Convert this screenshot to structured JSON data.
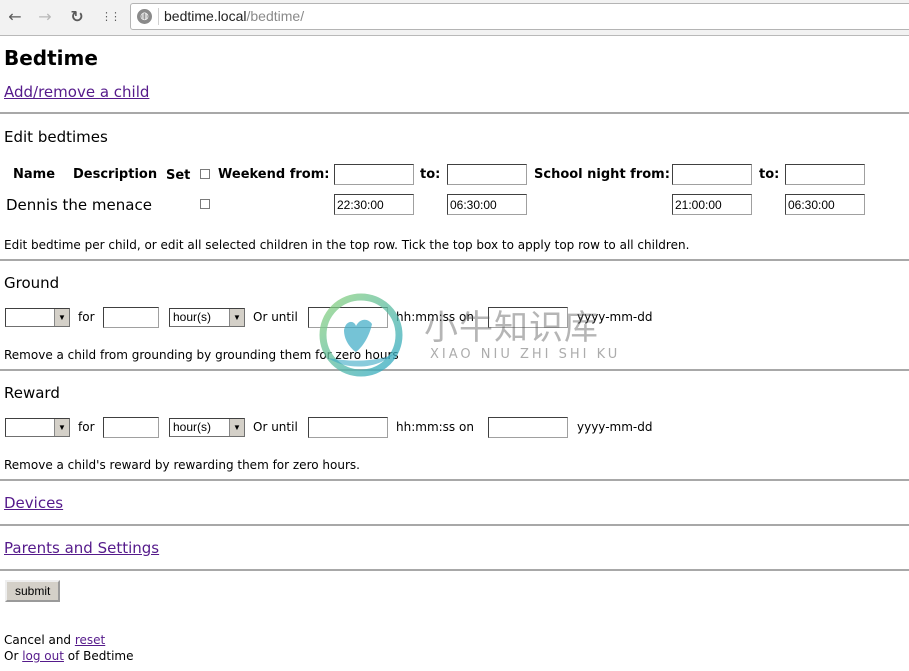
{
  "browser": {
    "url_host": "bedtime.local",
    "url_path": "/bedtime/",
    "back_icon": "←",
    "forward_icon": "→",
    "reload_icon": "↻",
    "apps_icon": "⋮⋮",
    "site_icon": "◍"
  },
  "page": {
    "title": "Bedtime",
    "add_remove_link": "Add/remove a child"
  },
  "edit_bedtimes": {
    "heading": "Edit bedtimes",
    "columns": {
      "name": "Name",
      "description": "Description",
      "set": "Set",
      "weekend_from": "Weekend from:",
      "to1": "to:",
      "school_night_from": "School night from:",
      "to2": "to:"
    },
    "top_row": {
      "set_checked": false,
      "weekend_from": "",
      "weekend_to": "",
      "school_from": "",
      "school_to": ""
    },
    "children": [
      {
        "name": "Dennis the menace",
        "description": "",
        "set_checked": false,
        "weekend_from": "22:30:00",
        "weekend_to": "06:30:00",
        "school_from": "21:00:00",
        "school_to": "06:30:00"
      }
    ],
    "help": "Edit bedtime per child, or edit all selected children in the top row. Tick the top box to apply top row to all children."
  },
  "ground": {
    "heading": "Ground",
    "child_select": "",
    "for_label": "for",
    "amount": "",
    "unit_select": "hour(s)",
    "or_until_label": "Or until",
    "time_value": "",
    "time_format": "hh:mm:ss on",
    "date_value": "",
    "date_format": "yyyy-mm-dd",
    "help": "Remove a child from grounding by grounding them for zero hours"
  },
  "reward": {
    "heading": "Reward",
    "child_select": "",
    "for_label": "for",
    "amount": "",
    "unit_select": "hour(s)",
    "or_until_label": "Or until",
    "time_value": "",
    "time_format": "hh:mm:ss on",
    "date_value": "",
    "date_format": "yyyy-mm-dd",
    "help": "Remove a child's reward by rewarding them for zero hours."
  },
  "links": {
    "devices": "Devices",
    "parents_settings": "Parents and Settings"
  },
  "form": {
    "submit": "submit",
    "cancel_prefix": "Cancel and ",
    "reset_link": "reset",
    "logout_prefix": "Or ",
    "logout_link": "log out",
    "logout_suffix": " of Bedtime"
  },
  "watermark": {
    "text": "小牛知识库",
    "sub": "XIAO NIU ZHI SHI KU"
  }
}
